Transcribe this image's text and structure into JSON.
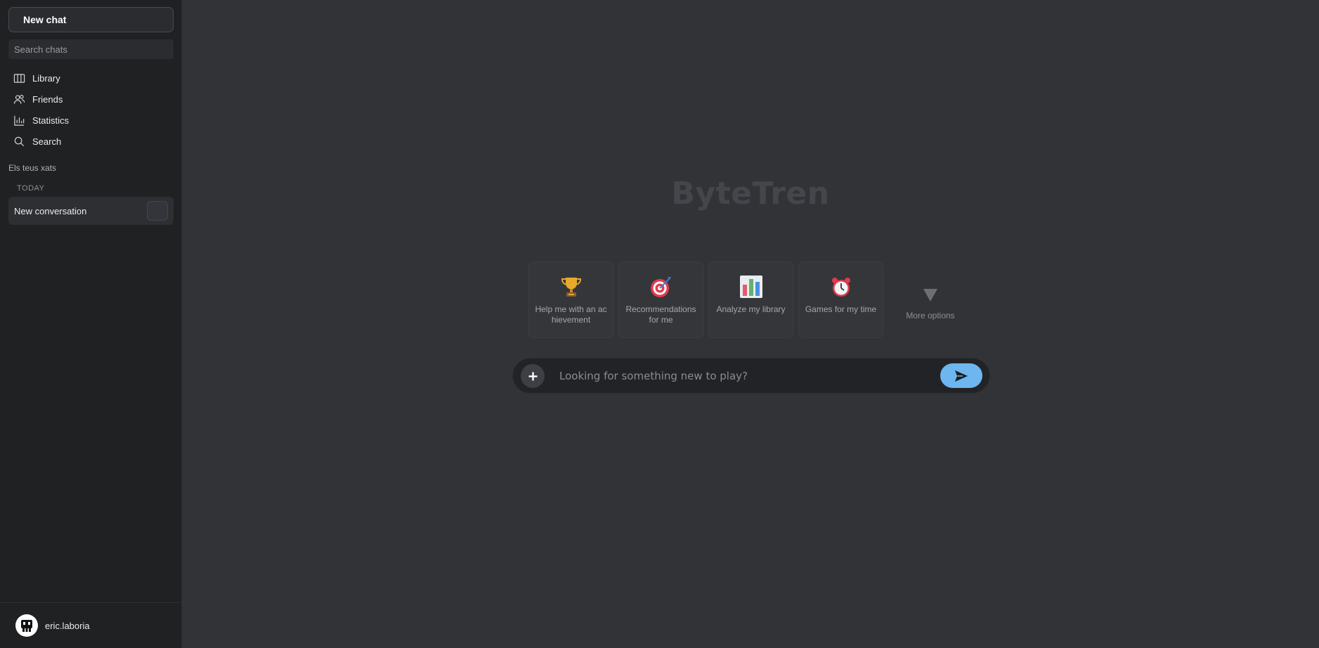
{
  "sidebar": {
    "new_chat_label": "New chat",
    "search_placeholder": "Search chats",
    "nav": [
      {
        "label": "Library",
        "icon": "library-icon"
      },
      {
        "label": "Friends",
        "icon": "friends-icon"
      },
      {
        "label": "Statistics",
        "icon": "statistics-icon"
      },
      {
        "label": "Search",
        "icon": "search-icon"
      }
    ],
    "section_label": "Els teus xats",
    "today_label": "TODAY",
    "conversations": [
      {
        "title": "New conversation"
      }
    ],
    "user": {
      "name": "eric.laboria",
      "avatar_icon": "robot-avatar-icon"
    }
  },
  "main": {
    "brand": "ByteTren",
    "suggestions": [
      {
        "label": "Help me with an achievement",
        "icon": "trophy-icon"
      },
      {
        "label": "Recommendations for me",
        "icon": "target-icon"
      },
      {
        "label": "Analyze my library",
        "icon": "bar-chart-icon"
      },
      {
        "label": "Games for my time",
        "icon": "alarm-clock-icon"
      }
    ],
    "more_options_label": "More options",
    "composer": {
      "placeholder": "Looking for something new to play?"
    }
  },
  "colors": {
    "background": "#323337",
    "sidebar": "#202123",
    "accent": "#6db6ef"
  }
}
